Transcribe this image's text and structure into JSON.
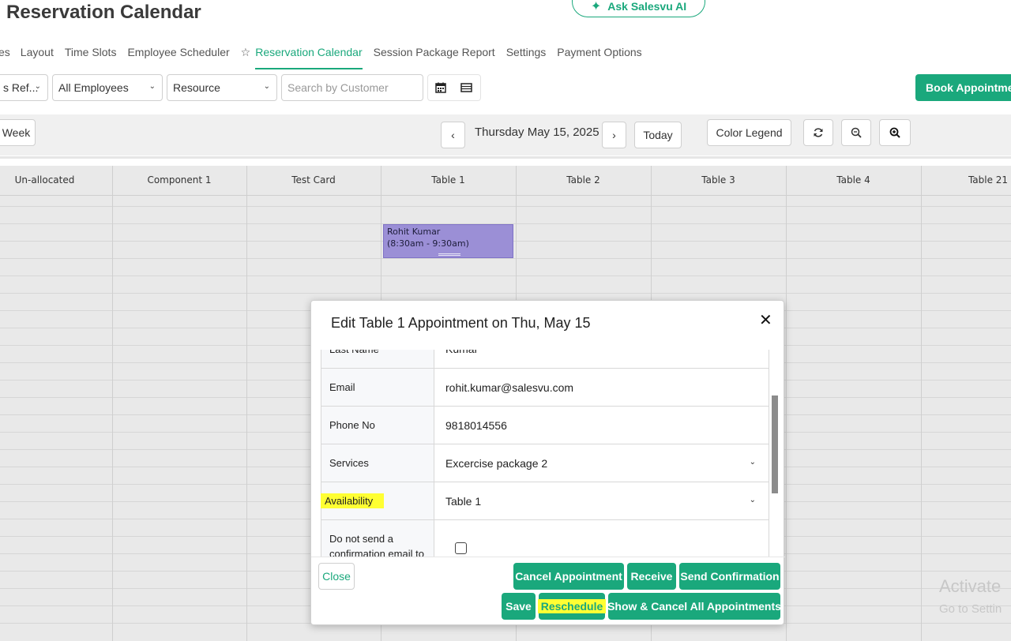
{
  "page": {
    "title": "Reservation Calendar"
  },
  "ask_button": {
    "label": "Ask Salesvu AI",
    "icon": "sparkle-icon"
  },
  "tabs": [
    {
      "label": "es"
    },
    {
      "label": "Layout"
    },
    {
      "label": "Time Slots"
    },
    {
      "label": "Employee Scheduler"
    },
    {
      "label": "Reservation Calendar",
      "active": true
    },
    {
      "label": "Session Package Report"
    },
    {
      "label": "Settings"
    },
    {
      "label": "Payment Options"
    }
  ],
  "filters": {
    "ref_select": "s Ref...",
    "employees_select": "All Employees",
    "resource_select": "Resource",
    "search_placeholder": "Search by Customer",
    "book_button": "Book Appointment"
  },
  "toolbar": {
    "week_button": "Week",
    "date": "Thursday May 15, 2025",
    "today_button": "Today",
    "color_legend_button": "Color Legend"
  },
  "columns": [
    "Un-allocated",
    "Component 1",
    "Test Card",
    "Table 1",
    "Table 2",
    "Table 3",
    "Table 4",
    "Table 21"
  ],
  "appointment": {
    "name": "Rohit Kumar",
    "time": "(8:30am - 9:30am)",
    "color": "#9b8fd6"
  },
  "modal": {
    "title": "Edit Table 1 Appointment on Thu, May 15",
    "fields": {
      "last_name_label": "Last Name",
      "last_name_value": "Kumar",
      "email_label": "Email",
      "email_value": "rohit.kumar@salesvu.com",
      "phone_label": "Phone No",
      "phone_value": "9818014556",
      "services_label": "Services",
      "services_value": "Excercise package 2",
      "availability_label": "Availability",
      "availability_value": "Table 1",
      "no_email_label": "Do not send a confirmation email to"
    },
    "buttons": {
      "close": "Close",
      "cancel_appointment": "Cancel Appointment",
      "receive": "Receive",
      "send_confirmation": "Send Confirmation",
      "save": "Save",
      "reschedule": "Reschedule",
      "show_cancel_all": "Show & Cancel All Appointments"
    }
  },
  "watermark": {
    "line1": "Activate",
    "line2": "Go to Settin"
  },
  "colors": {
    "accent": "#1aa87c",
    "highlight": "#ffff33"
  }
}
